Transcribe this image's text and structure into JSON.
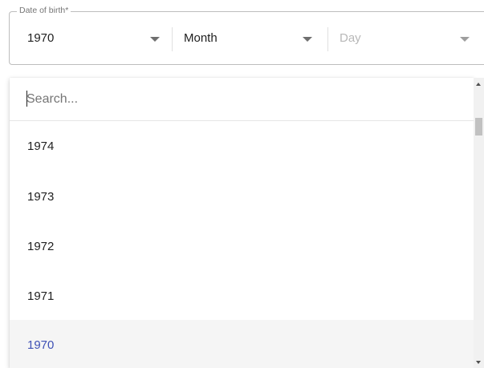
{
  "date_of_birth": {
    "legend": "Date of birth*",
    "year": {
      "value": "1970"
    },
    "month": {
      "placeholder": "Month"
    },
    "day": {
      "placeholder": "Day"
    }
  },
  "year_dropdown": {
    "search": {
      "value": "",
      "placeholder": "Search..."
    },
    "options": [
      {
        "label": "1974",
        "selected": false
      },
      {
        "label": "1973",
        "selected": false
      },
      {
        "label": "1972",
        "selected": false
      },
      {
        "label": "1971",
        "selected": false
      },
      {
        "label": "1970",
        "selected": true
      }
    ]
  },
  "icons": {
    "dropdown_arrow": "caret-down-icon",
    "scroll_up": "scroll-up-arrow-icon",
    "scroll_down": "scroll-down-arrow-icon"
  },
  "colors": {
    "selected_text": "#3f51b5",
    "selected_background": "#f5f5f5",
    "border": "#bdbdbd",
    "placeholder_text": "#b8b8b8"
  }
}
